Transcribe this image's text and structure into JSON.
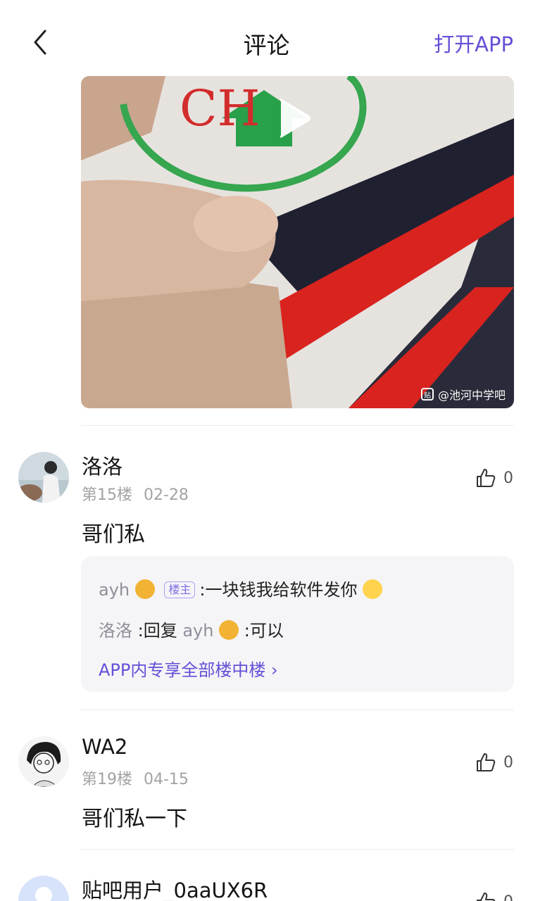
{
  "header": {
    "title": "评论",
    "open_app": "打开APP"
  },
  "video": {
    "watermark": "@池河中学吧",
    "watermark_icon_char": "贴"
  },
  "comments": [
    {
      "username": "洛洛",
      "floor": "第15楼",
      "date": "02-28",
      "likes": "0",
      "text": "哥们私",
      "replies": [
        {
          "user": "ayh",
          "badge": "楼主",
          "text": ":一块钱我给软件发你"
        },
        {
          "user": "洛洛",
          "reply_prefix": " :回复 ",
          "reply_to": "ayh",
          "text": " :可以"
        }
      ],
      "more_label": "APP内专享全部楼中楼 ›"
    },
    {
      "username": "WA2",
      "floor": "第19楼",
      "date": "04-15",
      "likes": "0",
      "text": "哥们私一下"
    },
    {
      "username": "贴吧用户_0aaUX6R",
      "likes": "0"
    }
  ],
  "colors": {
    "accent": "#6350d6",
    "meta_gray": "#a3a3a3",
    "reply_bg": "#f5f5f8"
  }
}
